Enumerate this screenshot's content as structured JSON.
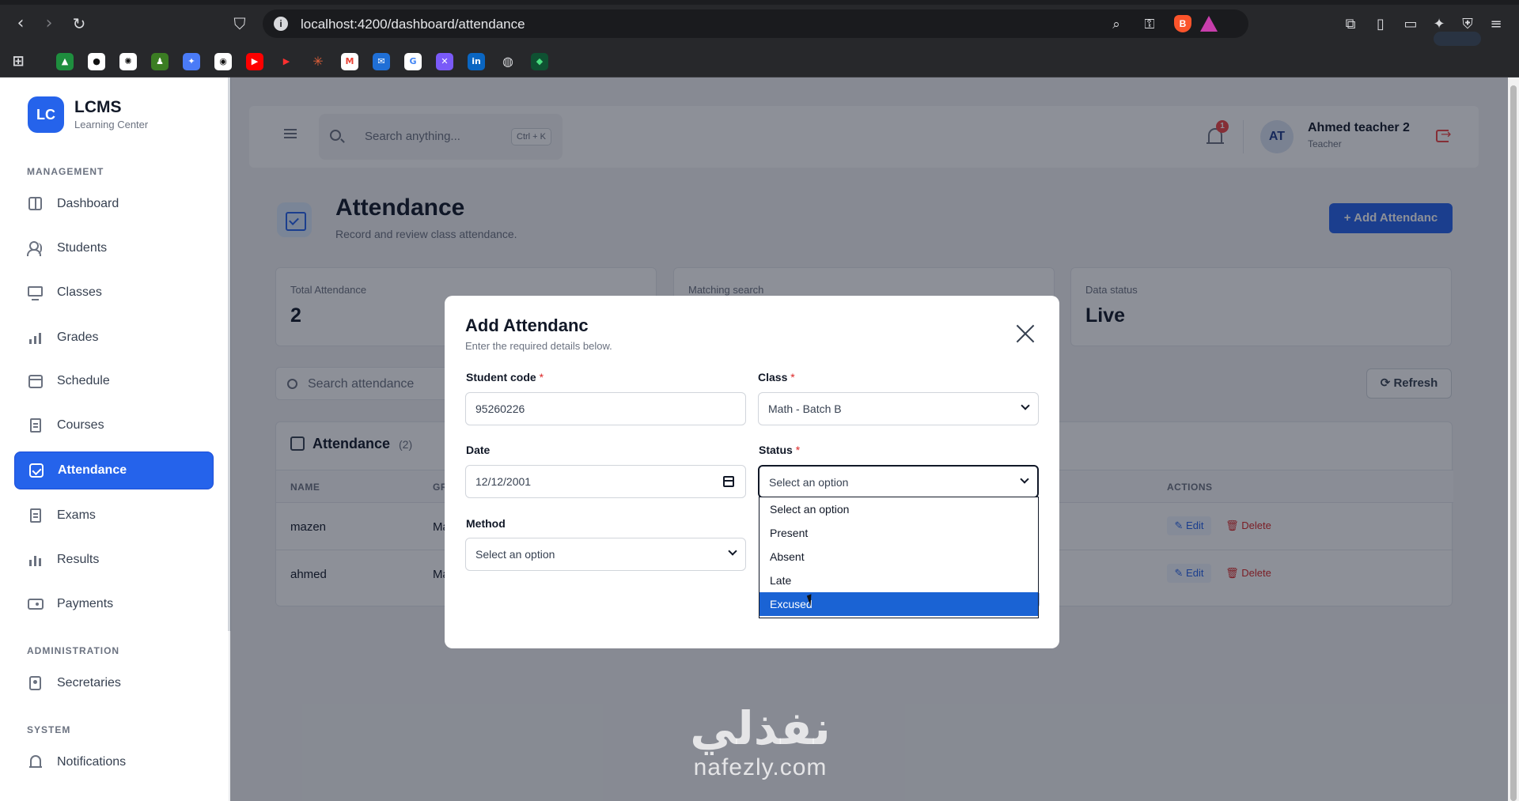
{
  "browser": {
    "url": "localhost:4200/dashboard/attendance"
  },
  "sidebar": {
    "brand": {
      "logo": "LC",
      "name": "LCMS",
      "subtitle": "Learning Center"
    },
    "sections": {
      "management": "MANAGEMENT",
      "administration": "ADMINISTRATION",
      "system": "SYSTEM"
    },
    "items": [
      {
        "label": "Dashboard",
        "icon": "dashboard-icon"
      },
      {
        "label": "Students",
        "icon": "users-icon"
      },
      {
        "label": "Classes",
        "icon": "monitor-icon"
      },
      {
        "label": "Grades",
        "icon": "bar-chart-icon"
      },
      {
        "label": "Schedule",
        "icon": "calendar-icon"
      },
      {
        "label": "Courses",
        "icon": "clipboard-icon"
      },
      {
        "label": "Attendance",
        "icon": "calendar-check-icon",
        "active": true
      },
      {
        "label": "Exams",
        "icon": "clipboard-icon"
      },
      {
        "label": "Results",
        "icon": "bar-chart-icon"
      },
      {
        "label": "Payments",
        "icon": "wallet-icon"
      },
      {
        "label": "Secretaries",
        "icon": "id-badge-icon"
      },
      {
        "label": "Notifications",
        "icon": "bell-icon"
      }
    ]
  },
  "topbar": {
    "search_placeholder": "Search anything...",
    "shortcut": "Ctrl + K",
    "notification_count": "1",
    "user": {
      "initials": "AT",
      "name": "Ahmed teacher 2",
      "role": "Teacher"
    }
  },
  "page": {
    "title": "Attendance",
    "subtitle": "Record and review class attendance.",
    "add_button": "+ Add Attendanc"
  },
  "stats": [
    {
      "label": "Total Attendance",
      "value": "2"
    },
    {
      "label": "Matching search",
      "value": ""
    },
    {
      "label": "Data status",
      "value": "Live"
    }
  ],
  "list": {
    "search_placeholder": "Search attendance",
    "refresh_label": "⟳ Refresh",
    "table_title": "Attendance",
    "table_count": "(2)",
    "columns": [
      "NAME",
      "GR",
      "ACTIONS"
    ],
    "rows": [
      {
        "name": "mazen",
        "col2": "Ma"
      },
      {
        "name": "ahmed",
        "col2": "Ma"
      }
    ],
    "edit_label": "✎ Edit",
    "delete_label": "🗑 Delete"
  },
  "modal": {
    "title": "Add Attendanc",
    "subtitle": "Enter the required details below.",
    "fields": {
      "student_code": {
        "label": "Student code",
        "value": "95260226"
      },
      "class": {
        "label": "Class",
        "value": "Math - Batch B"
      },
      "date": {
        "label": "Date",
        "value": "12/12/2001"
      },
      "status": {
        "label": "Status",
        "value": "Select an option"
      },
      "method": {
        "label": "Method",
        "value": "Select an option"
      }
    },
    "required_mark": "*",
    "status_options": [
      "Select an option",
      "Present",
      "Absent",
      "Late",
      "Excused"
    ],
    "status_highlighted": "Excused"
  },
  "watermark": {
    "arabic": "نفذلي",
    "latin": "nafezly.com"
  },
  "colors": {
    "accent": "#2563eb",
    "danger": "#dc2626",
    "highlight": "#1a63d4"
  }
}
